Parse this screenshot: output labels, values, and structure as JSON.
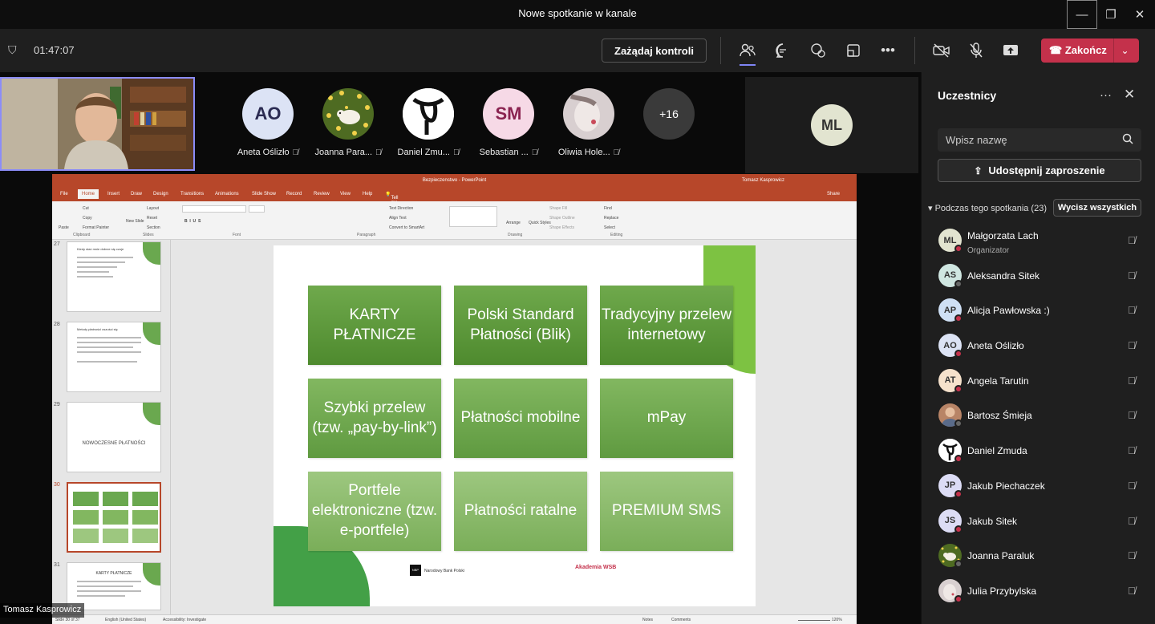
{
  "window": {
    "title": "Nowe spotkanie w kanale",
    "min": "—",
    "max": "❐",
    "close": "✕"
  },
  "toolbar": {
    "timer": "01:47:07",
    "request_control": "Zażądaj kontroli",
    "end_label": "Zakończ",
    "icons": [
      "participants-icon",
      "chat-icon",
      "reactions-icon",
      "rooms-icon",
      "more-icon",
      "camera-off-icon",
      "mic-off-icon",
      "share-icon"
    ]
  },
  "stage": {
    "self_name": "Tomasz Kasprowicz",
    "gallery": [
      {
        "initials": "AO",
        "name": "Aneta Oślizło",
        "color": "#dce3f5"
      },
      {
        "initials": "",
        "name": "Joanna Para...",
        "color": "#5b7a2c"
      },
      {
        "initials": "",
        "name": "Daniel Zmu...",
        "color": "#ffffff"
      },
      {
        "initials": "SM",
        "name": "Sebastian ...",
        "color": "#f6d9e6"
      },
      {
        "initials": "",
        "name": "Oliwia Hole...",
        "color": "#d8cfd0"
      }
    ],
    "more_count": "+16",
    "ml_initials": "ML"
  },
  "ppt": {
    "title": "Bezpieczenstwo  -  PowerPoint",
    "user": "Tomasz Kasprowicz",
    "menu": [
      "File",
      "Home",
      "Insert",
      "Draw",
      "Design",
      "Transitions",
      "Animations",
      "Slide Show",
      "Record",
      "Review",
      "View",
      "Help"
    ],
    "tell_me": "Tell me what you want to do",
    "share": "Share",
    "ribbon": {
      "clipboard": "Clipboard",
      "slides": "Slides",
      "font": "Font",
      "paragraph": "Paragraph",
      "drawing": "Drawing",
      "editing": "Editing",
      "paste": "Paste",
      "cut": "Cut",
      "copy": "Copy",
      "format_painter": "Format Painter",
      "new_slide": "New Slide",
      "layout": "Layout",
      "reset": "Reset",
      "section": "Section",
      "text_direction": "Text Direction",
      "align_text": "Align Text",
      "smartart": "Convert to SmartArt",
      "arrange": "Arrange",
      "quick_styles": "Quick Styles",
      "shape_fill": "Shape Fill",
      "shape_outline": "Shape Outline",
      "shape_effects": "Shape Effects",
      "find": "Find",
      "replace": "Replace",
      "select": "Select"
    },
    "thumbs": [
      {
        "num": "27",
        "title": "Kiedy stać mnie dobrze się czuje"
      },
      {
        "num": "28",
        "title": "Metody płatności oszuści się"
      },
      {
        "num": "29",
        "title": "NOWOCZESNE PŁATNOŚCI"
      },
      {
        "num": "30",
        "title": ""
      },
      {
        "num": "31",
        "title": "KARTY PŁATNICZE"
      }
    ],
    "slide_tiles": [
      "KARTY PŁATNICZE",
      "Polski Standard Płatności (Blik)",
      "Tradycyjny przelew internetowy",
      "Szybki przelew (tzw. „pay-by-link”)",
      "Płatności mobilne",
      "mPay",
      "Portfele elektroniczne (tzw. e-portfele)",
      "Płatności ratalne",
      "PREMIUM SMS"
    ],
    "footer": {
      "nbp": "Narodowy Bank Polski",
      "wsb": "Akademia WSB"
    },
    "status": {
      "slide": "Slide 30 of 37",
      "lang": "English (United States)",
      "access": "Accessibility: Investigate",
      "notes": "Notes",
      "comments": "Comments",
      "zoom": "120%"
    }
  },
  "panel": {
    "title": "Uczestnicy",
    "search_placeholder": "Wpisz nazwę",
    "invite": "Udostępnij zaproszenie",
    "section": "Podczas tego spotkania (23)",
    "mute_all": "Wycisz wszystkich",
    "people": [
      {
        "initials": "ML",
        "name": "Małgorzata Lach",
        "sub": "Organizator",
        "color": "#e2e4d0"
      },
      {
        "initials": "AS",
        "name": "Aleksandra Sitek",
        "sub": "",
        "color": "#cfe6e1"
      },
      {
        "initials": "AP",
        "name": "Alicja Pawłowska :)",
        "sub": "",
        "color": "#cfe0f5"
      },
      {
        "initials": "AO",
        "name": "Aneta Oślizło",
        "sub": "",
        "color": "#dce3f5"
      },
      {
        "initials": "AT",
        "name": "Angela Tarutin",
        "sub": "",
        "color": "#f6e2cc"
      },
      {
        "initials": "",
        "name": "Bartosz Śmieja",
        "sub": "",
        "color": "#c98a6c"
      },
      {
        "initials": "",
        "name": "Daniel Zmuda",
        "sub": "",
        "color": "#ffffff"
      },
      {
        "initials": "JP",
        "name": "Jakub Piechaczek",
        "sub": "",
        "color": "#dcdcf5"
      },
      {
        "initials": "JS",
        "name": "Jakub Sitek",
        "sub": "",
        "color": "#dcdcf5"
      },
      {
        "initials": "",
        "name": "Joanna Paraluk",
        "sub": "",
        "color": "#5b7a2c"
      },
      {
        "initials": "",
        "name": "Julia Przybylska",
        "sub": "",
        "color": "#d8cfd0"
      }
    ]
  }
}
